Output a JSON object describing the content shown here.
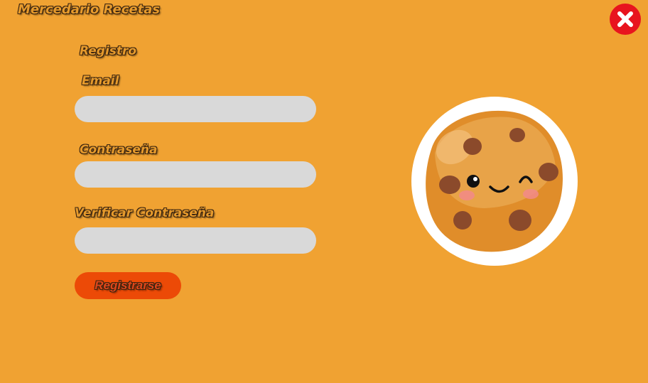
{
  "app": {
    "title": "Mercedario Recetas"
  },
  "form": {
    "title": "Registro",
    "email_label": "Email",
    "email_value": "",
    "password_label": "Contraseña",
    "password_value": "",
    "verify_label": "Verificar Contraseña",
    "verify_value": "",
    "submit_label": "Registrarse"
  },
  "icons": {
    "close": "close-icon",
    "illustration": "cookie-illustration"
  },
  "colors": {
    "background": "#f0a232",
    "input": "#d9d9d9",
    "button": "#ec4a07",
    "close": "#e8141e"
  }
}
